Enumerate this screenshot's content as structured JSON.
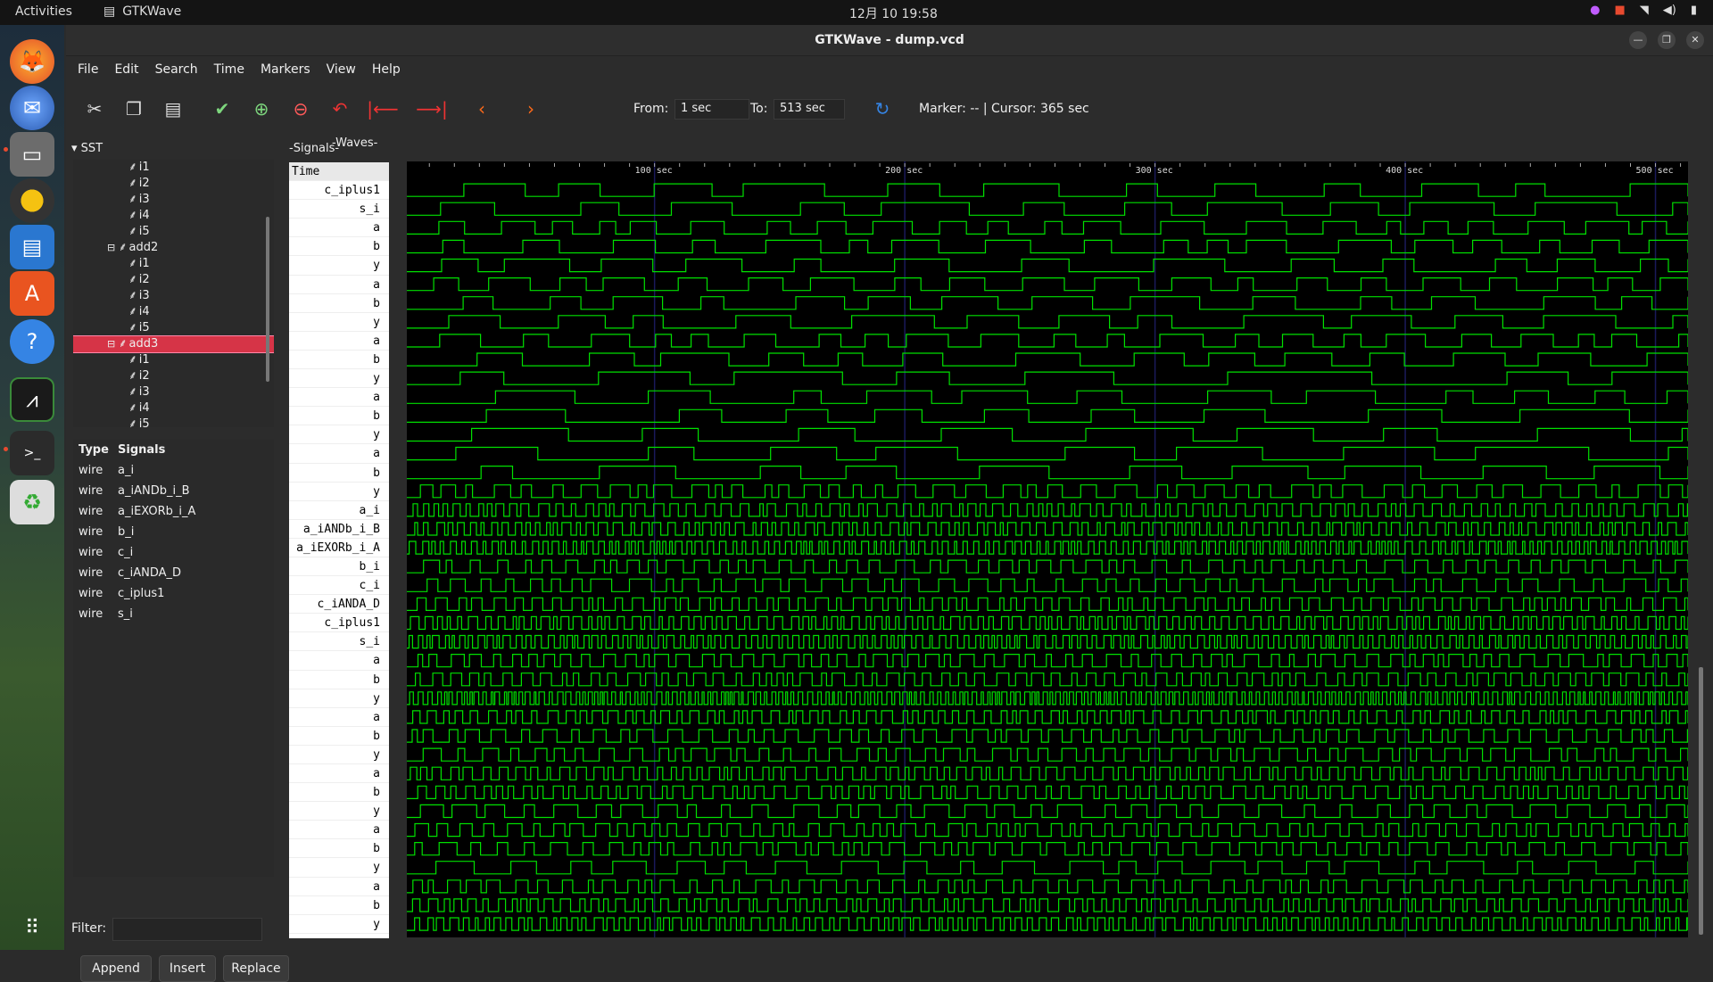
{
  "topbar": {
    "activities": "Activities",
    "app_name": "GTKWave",
    "clock": "12月 10  19:58"
  },
  "window": {
    "title": "GTKWave - dump.vcd"
  },
  "menu": [
    "File",
    "Edit",
    "Search",
    "Time",
    "Markers",
    "View",
    "Help"
  ],
  "toolbar": {
    "from_label": "From:",
    "from_value": "1 sec",
    "to_label": "To:",
    "to_value": "513 sec",
    "marker_text": "Marker: --  |  Cursor: 365 sec"
  },
  "sst": {
    "header": "SST",
    "tree": [
      {
        "label": "i1",
        "indent": 2
      },
      {
        "label": "i2",
        "indent": 2
      },
      {
        "label": "i3",
        "indent": 2
      },
      {
        "label": "i4",
        "indent": 2
      },
      {
        "label": "i5",
        "indent": 2
      },
      {
        "label": "add2",
        "indent": 1,
        "expander": true
      },
      {
        "label": "i1",
        "indent": 2
      },
      {
        "label": "i2",
        "indent": 2
      },
      {
        "label": "i3",
        "indent": 2
      },
      {
        "label": "i4",
        "indent": 2
      },
      {
        "label": "i5",
        "indent": 2
      },
      {
        "label": "add3",
        "indent": 1,
        "expander": true,
        "selected": true
      },
      {
        "label": "i1",
        "indent": 2
      },
      {
        "label": "i2",
        "indent": 2
      },
      {
        "label": "i3",
        "indent": 2
      },
      {
        "label": "i4",
        "indent": 2
      },
      {
        "label": "i5",
        "indent": 2
      }
    ]
  },
  "types_table": {
    "col_type": "Type",
    "col_signals": "Signals",
    "rows": [
      {
        "type": "wire",
        "name": "a_i"
      },
      {
        "type": "wire",
        "name": "a_iANDb_i_B"
      },
      {
        "type": "wire",
        "name": "a_iEXORb_i_A"
      },
      {
        "type": "wire",
        "name": "b_i"
      },
      {
        "type": "wire",
        "name": "c_i"
      },
      {
        "type": "wire",
        "name": "c_iANDA_D"
      },
      {
        "type": "wire",
        "name": "c_iplus1"
      },
      {
        "type": "wire",
        "name": "s_i"
      }
    ]
  },
  "filter_label": "Filter:",
  "buttons": {
    "append": "Append",
    "insert": "Insert",
    "replace": "Replace"
  },
  "signals_header": "Signals",
  "waves_header": "Waves",
  "signal_names": [
    "Time",
    "c_iplus1",
    "s_i",
    "a",
    "b",
    "y",
    "a",
    "b",
    "y",
    "a",
    "b",
    "y",
    "a",
    "b",
    "y",
    "a",
    "b",
    "y",
    "a_i",
    "a_iANDb_i_B",
    "a_iEXORb_i_A",
    "b_i",
    "c_i",
    "c_iANDA_D",
    "c_iplus1",
    "s_i",
    "a",
    "b",
    "y",
    "a",
    "b",
    "y",
    "a",
    "b",
    "y",
    "a",
    "b",
    "y",
    "a",
    "b",
    "y"
  ],
  "time_axis": {
    "labels": [
      "100 sec",
      "200 sec",
      "300 sec",
      "400 sec",
      "500 sec"
    ],
    "values": [
      100,
      200,
      300,
      400,
      500
    ],
    "range": [
      1,
      513
    ]
  },
  "colors": {
    "wave": "#00e000",
    "grid": "#1a1a5a",
    "selected": "#d63447"
  }
}
